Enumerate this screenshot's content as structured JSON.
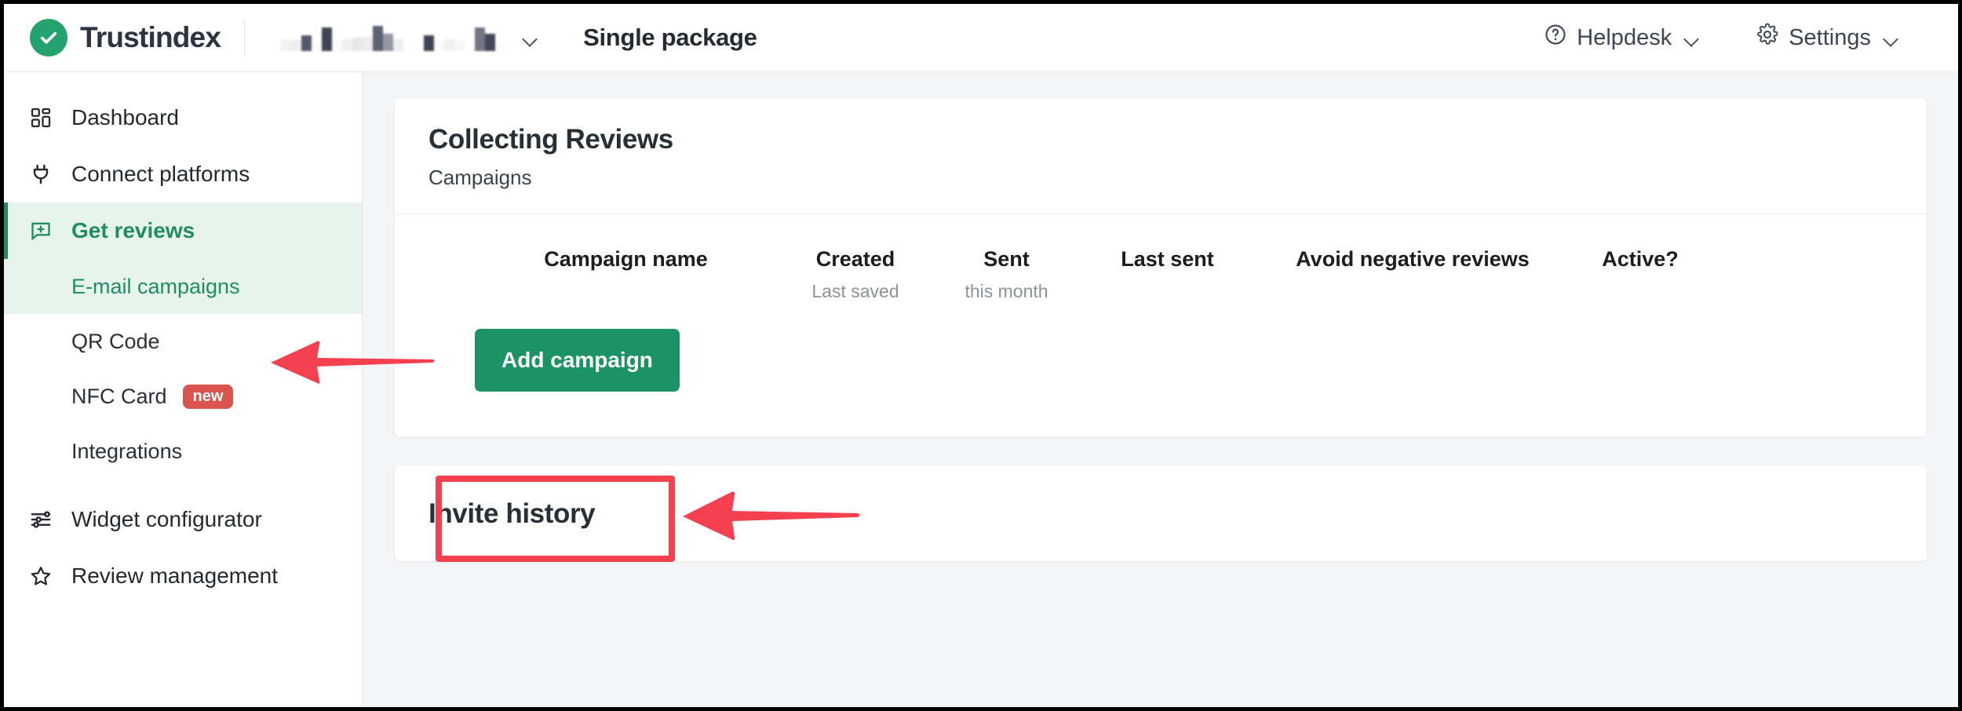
{
  "topbar": {
    "brand_name": "Trustindex",
    "brand_logo_icon": "check-circle-icon",
    "account_name_redacted": "",
    "account_chevron_icon": "chevron-down-icon",
    "package_title": "Single package",
    "helpdesk_label": "Helpdesk",
    "helpdesk_icon": "question-circle-icon",
    "settings_label": "Settings",
    "settings_icon": "gear-icon"
  },
  "sidebar": {
    "items": [
      {
        "label": "Dashboard",
        "icon": "grid-icon",
        "active": false
      },
      {
        "label": "Connect platforms",
        "icon": "plug-icon",
        "active": false
      },
      {
        "label": "Get reviews",
        "icon": "chat-plus-icon",
        "active": true
      },
      {
        "label": "Widget configurator",
        "icon": "sliders-icon",
        "active": false
      },
      {
        "label": "Review management",
        "icon": "star-icon",
        "active": false
      }
    ],
    "subitems": [
      {
        "label": "E-mail campaigns",
        "active": true,
        "badge": ""
      },
      {
        "label": "QR Code",
        "active": false,
        "badge": ""
      },
      {
        "label": "NFC Card",
        "active": false,
        "badge": "new"
      },
      {
        "label": "Integrations",
        "active": false,
        "badge": ""
      }
    ]
  },
  "main": {
    "collecting": {
      "title": "Collecting Reviews",
      "subtitle": "Campaigns",
      "columns": [
        {
          "label": "Campaign name",
          "sub": ""
        },
        {
          "label": "Created",
          "sub": "Last saved"
        },
        {
          "label": "Sent",
          "sub": "this month"
        },
        {
          "label": "Last sent",
          "sub": ""
        },
        {
          "label": "Avoid negative reviews",
          "sub": ""
        },
        {
          "label": "Active?",
          "sub": ""
        }
      ],
      "add_campaign_label": "Add campaign"
    },
    "invite_history": {
      "title": "Invite history"
    }
  },
  "colors": {
    "brand_green": "#25a36f",
    "button_green": "#1c9367",
    "active_nav_bg": "#e7f3ed",
    "active_nav_text": "#1f8f61",
    "badge_red": "#d9534f",
    "annotation_red": "#f4404f",
    "heading_dark": "#253039"
  }
}
